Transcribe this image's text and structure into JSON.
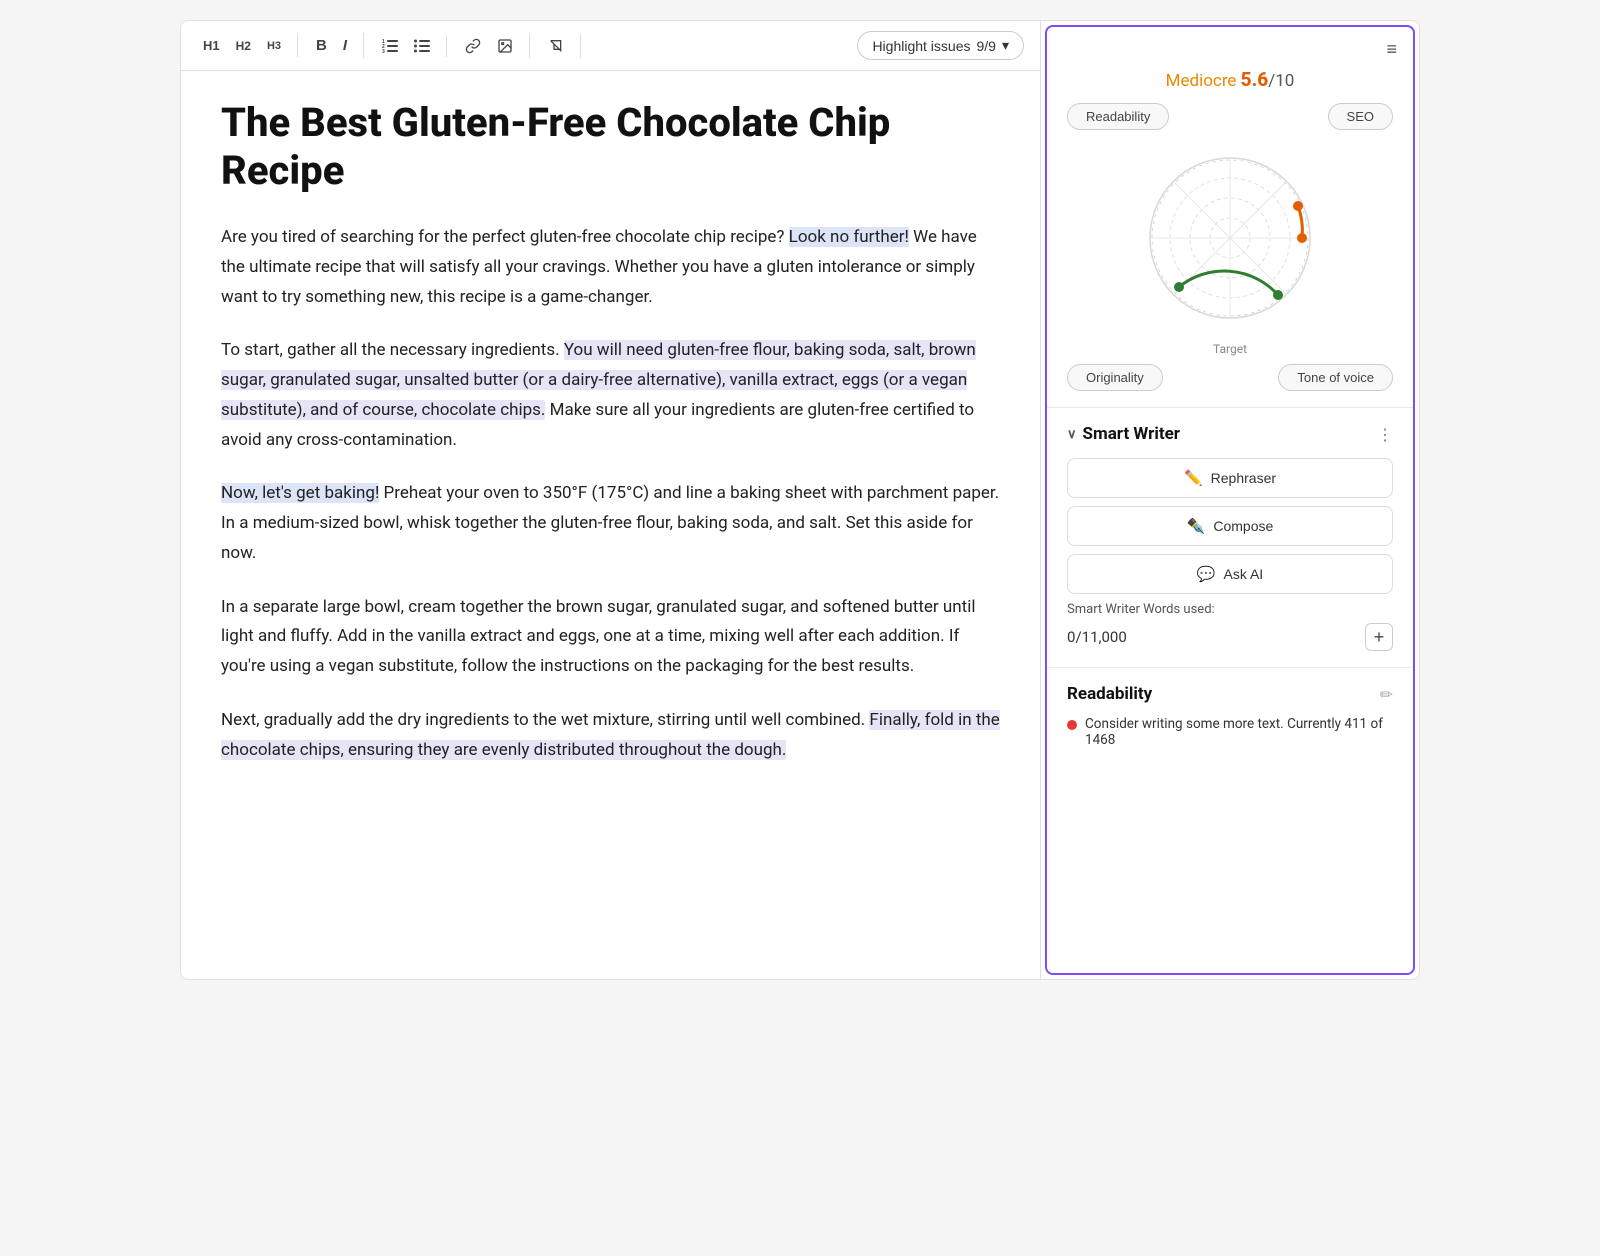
{
  "toolbar": {
    "h1": "H1",
    "h2": "H2",
    "h3": "H3",
    "bold": "B",
    "italic": "I",
    "highlight_label": "Highlight issues",
    "highlight_count": "9/9"
  },
  "editor": {
    "title": "The Best Gluten-Free Chocolate Chip Recipe",
    "paragraphs": [
      {
        "id": "p1",
        "text_parts": [
          {
            "text": "Are you tired of searching for the perfect gluten-free chocolate chip recipe? ",
            "highlight": false
          },
          {
            "text": "Look no further!",
            "highlight": "blue"
          },
          {
            "text": " We have the ultimate recipe that will satisfy all your cravings. Whether you have a gluten intolerance or simply want to try something new, this recipe is a game-changer.",
            "highlight": false
          }
        ]
      },
      {
        "id": "p2",
        "text_parts": [
          {
            "text": "To start, gather all the necessary ingredients. ",
            "highlight": false
          },
          {
            "text": "You will need gluten-free flour, baking soda, salt, brown sugar, granulated sugar, unsalted butter (or a dairy-free alternative), vanilla extract, eggs (or a vegan substitute), and of course, chocolate chips.",
            "highlight": "purple"
          },
          {
            "text": " Make sure all your ingredients are gluten-free certified to avoid any cross-contamination.",
            "highlight": false
          }
        ]
      },
      {
        "id": "p3",
        "text_parts": [
          {
            "text": "",
            "highlight": false
          },
          {
            "text": "Now, let's get baking!",
            "highlight": "blue"
          },
          {
            "text": " Preheat your oven to 350°F (175°C) and line a baking sheet with parchment paper. In a medium-sized bowl, whisk together the gluten-free flour, baking soda, and salt. Set this aside for now.",
            "highlight": false
          }
        ]
      },
      {
        "id": "p4",
        "text_parts": [
          {
            "text": "In a separate large bowl, cream together the brown sugar, granulated sugar, and softened butter until light and fluffy. Add in the vanilla extract and eggs, one at a time, mixing well after each addition. If you're using a vegan substitute, follow the instructions on the packaging for the best results.",
            "highlight": false
          }
        ]
      },
      {
        "id": "p5",
        "text_parts": [
          {
            "text": "Next, gradually add the dry ingredients to the wet mixture, stirring until well combined. ",
            "highlight": false
          },
          {
            "text": "Finally, fold in the chocolate chips, ensuring they are evenly distributed throughout the dough.",
            "highlight": "purple"
          },
          {
            "text": "",
            "highlight": false
          }
        ]
      }
    ]
  },
  "right_panel": {
    "menu_icon": "≡",
    "score": {
      "label": "Mediocre",
      "value": "5.6",
      "max": "/10"
    },
    "tabs_top": [
      {
        "label": "Readability",
        "id": "readability"
      },
      {
        "label": "SEO",
        "id": "seo"
      }
    ],
    "radar_target_label": "Target",
    "tabs_bottom": [
      {
        "label": "Originality",
        "id": "originality"
      },
      {
        "label": "Tone of voice",
        "id": "tone-of-voice"
      }
    ],
    "smart_writer": {
      "title": "Smart Writer",
      "collapse_icon": "∨",
      "more_icon": "⋮",
      "buttons": [
        {
          "label": "Rephraser",
          "icon": "✏",
          "id": "rephraser"
        },
        {
          "label": "Compose",
          "icon": "✒",
          "id": "compose"
        },
        {
          "label": "Ask AI",
          "icon": "💬",
          "id": "ask-ai"
        }
      ],
      "words_label": "Smart Writer Words used:",
      "words_used": "0",
      "words_total": "11,000",
      "plus_icon": "+"
    },
    "readability": {
      "title": "Readability",
      "edit_icon": "✏",
      "items": [
        {
          "text": "Consider writing some more text. Currently 411 of 1468",
          "dot_color": "red"
        }
      ]
    }
  }
}
